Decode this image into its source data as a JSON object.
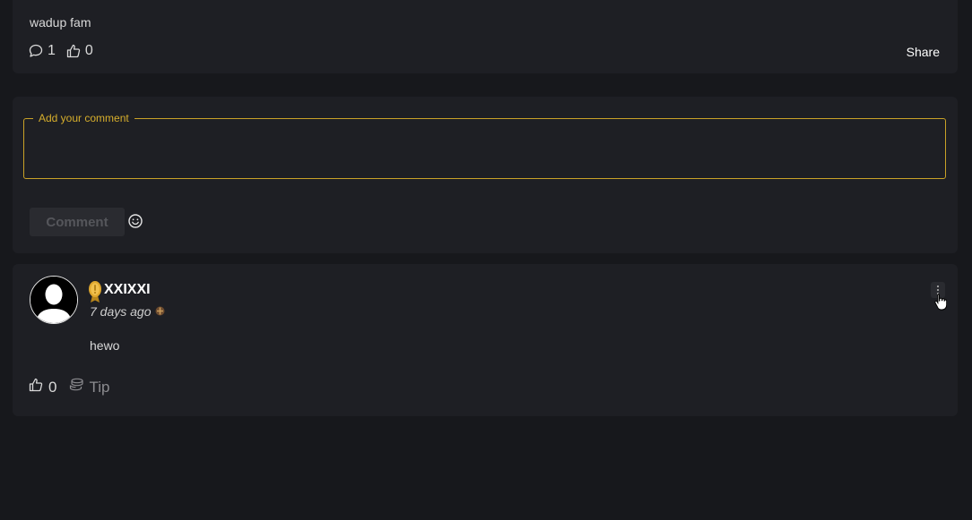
{
  "post": {
    "text": "wadup fam",
    "comment_count": "1",
    "like_count": "0",
    "share_label": "Share"
  },
  "comment_form": {
    "legend": "Add your comment",
    "value": "",
    "submit_label": "Comment",
    "emoji_icon": "smiley-icon"
  },
  "comment": {
    "username": "XXIXXI",
    "badge_icon": "gold-medal-icon",
    "time": "7 days ago",
    "text": "hewo",
    "like_count": "0",
    "tip_label": "Tip"
  },
  "colors": {
    "background": "#17181c",
    "card": "#1e1f24",
    "accent_gold": "#c9a227"
  }
}
